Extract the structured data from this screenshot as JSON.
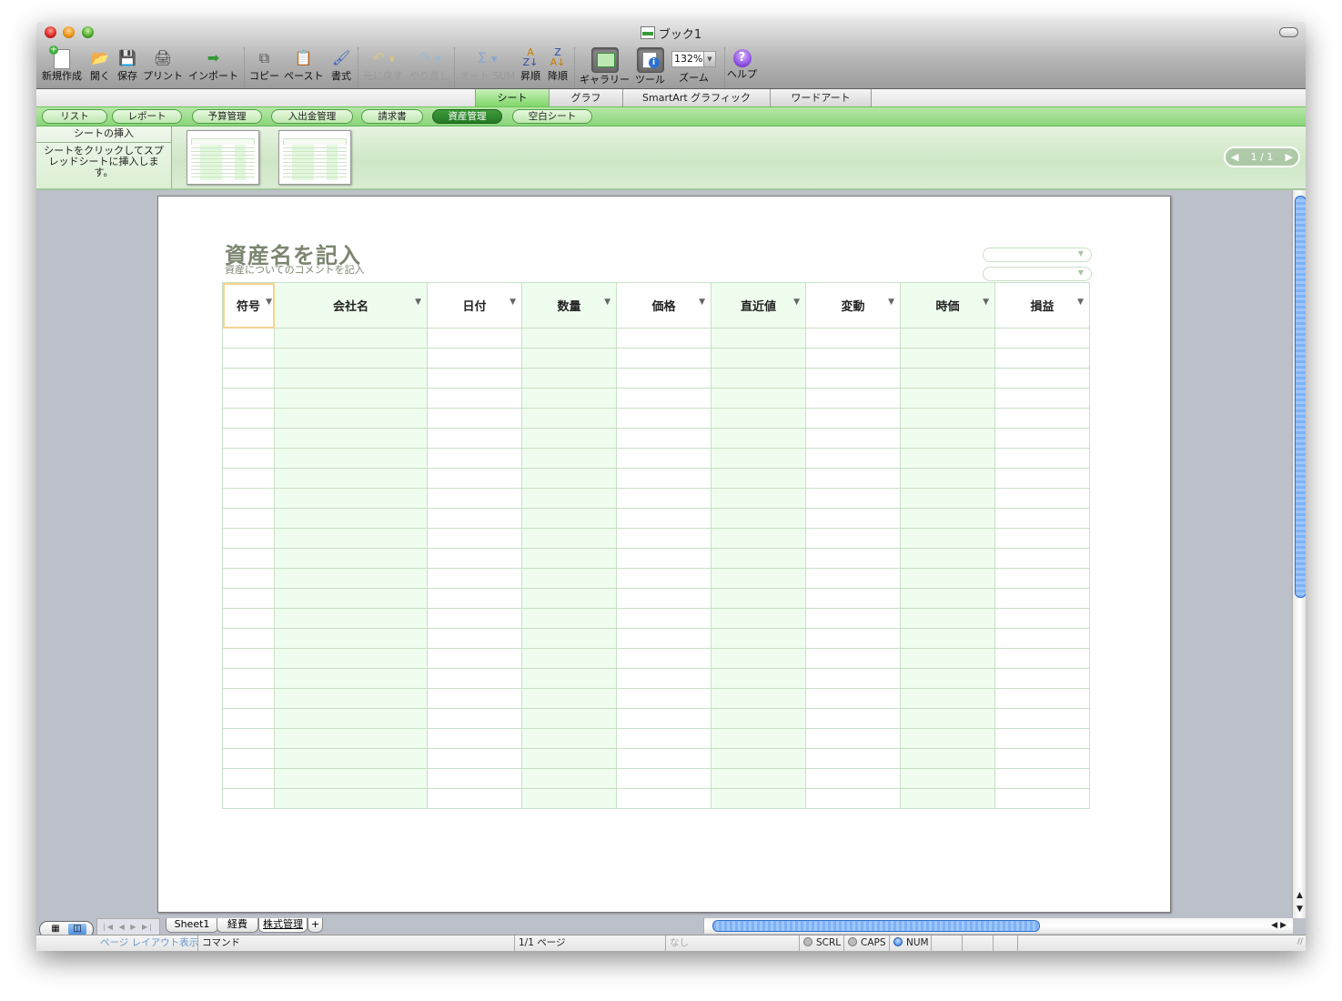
{
  "window": {
    "title": "ブック1"
  },
  "toolbar": {
    "items": [
      {
        "label": "新規作成",
        "icon": "new-workbook-icon"
      },
      {
        "label": "開く",
        "icon": "open-folder-icon"
      },
      {
        "label": "保存",
        "icon": "save-disk-icon"
      },
      {
        "label": "プリント",
        "icon": "printer-icon"
      },
      {
        "label": "インポート",
        "icon": "import-icon"
      },
      {
        "label": "コピー",
        "icon": "copy-icon"
      },
      {
        "label": "ペースト",
        "icon": "paste-icon"
      },
      {
        "label": "書式",
        "icon": "format-brush-icon"
      },
      {
        "label": "元に戻す",
        "icon": "undo-icon",
        "disabled": true
      },
      {
        "label": "やり直し",
        "icon": "redo-icon",
        "disabled": true
      },
      {
        "label": "オート SUM",
        "icon": "autosum-icon",
        "disabled": true
      },
      {
        "label": "昇順",
        "icon": "sort-ascending-icon"
      },
      {
        "label": "降順",
        "icon": "sort-descending-icon"
      },
      {
        "label": "ギャラリー",
        "icon": "gallery-icon"
      },
      {
        "label": "ツール",
        "icon": "toolbox-icon"
      },
      {
        "label": "ズーム",
        "icon": "zoom-select"
      },
      {
        "label": "ヘルプ",
        "icon": "help-icon"
      }
    ],
    "zoom_value": "132%"
  },
  "ribbon_tabs": [
    {
      "label": "シート",
      "active": true
    },
    {
      "label": "グラフ"
    },
    {
      "label": "SmartArt グラフィック"
    },
    {
      "label": "ワードアート"
    }
  ],
  "gallery_categories": [
    {
      "label": "リスト"
    },
    {
      "label": "レポート"
    },
    {
      "label": "予算管理"
    },
    {
      "label": "入出金管理"
    },
    {
      "label": "請求書"
    },
    {
      "label": "資産管理",
      "active": true
    },
    {
      "label": "空白シート"
    }
  ],
  "gallery": {
    "header": "シートの挿入",
    "description": "シートをクリックしてスプレッドシートに挿入します。",
    "pager": "1 / 1"
  },
  "sheet": {
    "title": "資産名を記入",
    "subtitle": "資産についてのコメントを記入",
    "columns": [
      "符号",
      "会社名",
      "日付",
      "数量",
      "価格",
      "直近値",
      "変動",
      "時価",
      "損益"
    ],
    "row_count": 24
  },
  "sheet_tabs": [
    {
      "label": "Sheet1"
    },
    {
      "label": "経費"
    },
    {
      "label": "株式管理",
      "active": true
    },
    {
      "label": "+"
    }
  ],
  "status_bar": {
    "view_mode": "ページ レイアウト表示",
    "mode": "コマンド",
    "page": "1/1 ページ",
    "sum": "なし",
    "scrl": "SCRL",
    "caps": "CAPS",
    "num": "NUM"
  }
}
